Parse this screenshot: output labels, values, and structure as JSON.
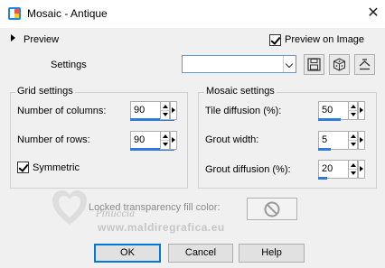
{
  "window": {
    "title": "Mosaic - Antique",
    "close_icon": "close-icon",
    "app_icon": "paintshop-pro-icon"
  },
  "preview": {
    "toggle_label": "Preview",
    "preview_on_image_label": "Preview on Image",
    "preview_on_image_checked": true
  },
  "settings": {
    "label": "Settings",
    "value": "",
    "toolbar": {
      "save_icon": "save-icon",
      "randomize_icon": "dice-icon",
      "reset_icon": "reset-icon"
    }
  },
  "grid_settings": {
    "title": "Grid settings",
    "columns_label": "Number of columns:",
    "columns_value": "90",
    "rows_label": "Number of rows:",
    "rows_value": "90",
    "symmetric_label": "Symmetric",
    "symmetric_checked": true
  },
  "mosaic_settings": {
    "title": "Mosaic settings",
    "tile_diffusion_label": "Tile diffusion (%):",
    "tile_diffusion_value": "50",
    "grout_width_label": "Grout width:",
    "grout_width_value": "5",
    "grout_diffusion_label": "Grout diffusion (%):",
    "grout_diffusion_value": "20"
  },
  "locked_transparency": {
    "label": "Locked transparency fill color:",
    "swatch_icon": "no-color-icon"
  },
  "watermark": {
    "name": "Pinuccia",
    "url": "www.maldiregrafica.eu"
  },
  "buttons": {
    "ok": "OK",
    "cancel": "Cancel",
    "help": "Help"
  },
  "colors": {
    "accent": "#0078d7",
    "spin_bar": "#2f7bd9",
    "background": "#f0f0f0"
  }
}
